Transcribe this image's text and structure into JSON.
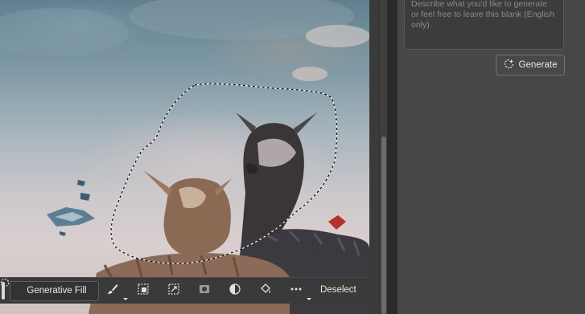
{
  "prompt_panel": {
    "placeholder": "Describe what you'd like to generate or feel free to leave this blank (English only).",
    "generate_label": "Generate"
  },
  "taskbar": {
    "generative_fill_label": "Generative Fill",
    "tools": [
      {
        "icon": "brush-icon"
      },
      {
        "icon": "transform-selection-icon"
      },
      {
        "icon": "invert-selection-icon"
      },
      {
        "icon": "mask-icon"
      },
      {
        "icon": "adjustment-icon"
      },
      {
        "icon": "fill-bucket-icon"
      },
      {
        "icon": "more-options-icon"
      }
    ],
    "deselect_label": "Deselect"
  },
  "canvas": {
    "content": "photo",
    "selection": "marching-ants lasso"
  }
}
